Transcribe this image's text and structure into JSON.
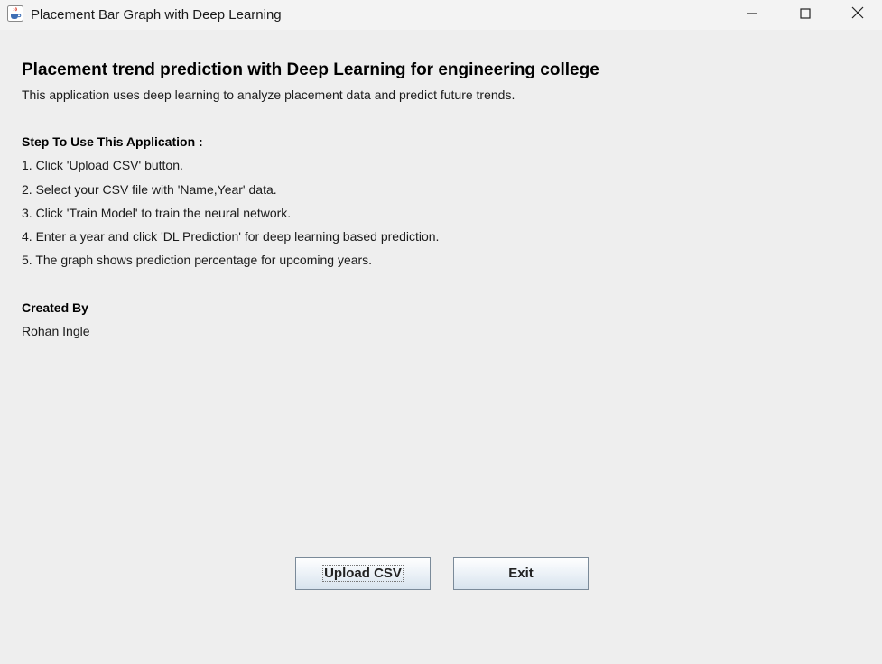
{
  "window": {
    "title": "Placement Bar Graph with Deep Learning",
    "app_icon": "java-coffee-icon",
    "controls": {
      "minimize_icon": "minimize-icon",
      "maximize_icon": "maximize-icon",
      "close_icon": "close-icon"
    }
  },
  "main": {
    "heading": "Placement trend prediction with Deep Learning for engineering college",
    "subtitle": "This application uses deep learning to analyze placement data and predict future trends.",
    "steps_heading": "Step To Use This Application :",
    "steps": [
      "1. Click 'Upload CSV' button.",
      "2. Select your CSV file with 'Name,Year' data.",
      "3. Click 'Train Model' to train the neural network.",
      "4. Enter a year and click 'DL Prediction' for deep learning based prediction.",
      "5. The graph shows prediction percentage for upcoming years."
    ],
    "created_heading": "Created By",
    "author": "Rohan Ingle"
  },
  "buttons": {
    "upload_label": "Upload CSV",
    "exit_label": "Exit"
  },
  "colors": {
    "background": "#eeeeee",
    "titlebar": "#f3f3f3",
    "button_border": "#7a8a99"
  }
}
